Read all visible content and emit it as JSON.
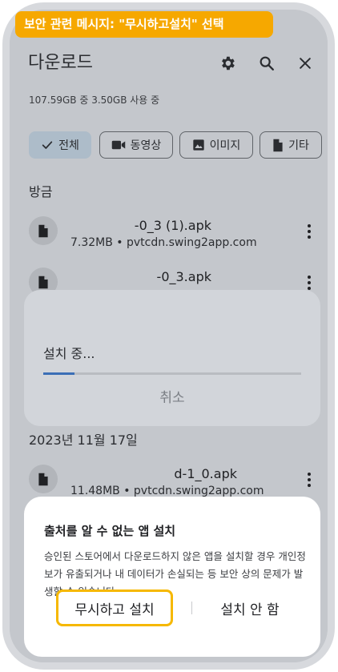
{
  "banner": {
    "text": "보안 관련 메시지: \"무시하고설치\" 선택"
  },
  "toolbar": {
    "title": "다운로드",
    "settings_icon": "gear-icon",
    "search_icon": "search-icon",
    "close_icon": "close-icon"
  },
  "storage": {
    "text": "107.59GB 중 3.50GB 사용 중"
  },
  "filters": [
    {
      "label": "전체",
      "icon": "check-icon",
      "selected": true
    },
    {
      "label": "동영상",
      "icon": "video-icon",
      "selected": false
    },
    {
      "label": "이미지",
      "icon": "image-icon",
      "selected": false
    },
    {
      "label": "기타",
      "icon": "document-icon",
      "selected": false
    }
  ],
  "sections": {
    "recent": "방금",
    "older": "2023년 11월 17일"
  },
  "files": [
    {
      "name": "-0_3 (1).apk",
      "meta": "7.32MB • pvtcdn.swing2app.com"
    },
    {
      "name": "-0_3.apk",
      "meta": ""
    },
    {
      "name": "d-1_0.apk",
      "meta": "11.48MB • pvtcdn.swing2app.com"
    }
  ],
  "install_sheet": {
    "status": "설치 중...",
    "progress": 0.12,
    "cancel_label": "취소"
  },
  "dialog": {
    "title": "출처를 알 수 없는 앱 설치",
    "body": "승인된 스토어에서 다운로드하지 않은 앱을 설치할 경우 개인정보가 유출되거나 내 데이터가 손실되는 등 보안 상의 문제가 발생할 수 있습니다.",
    "ignore_button": "무시하고 설치",
    "dont_install_button": "설치 안 함"
  },
  "colors": {
    "accent_highlight": "#f6a800",
    "chip_selected": "#adbcc9",
    "progress": "#3b6fb6"
  }
}
